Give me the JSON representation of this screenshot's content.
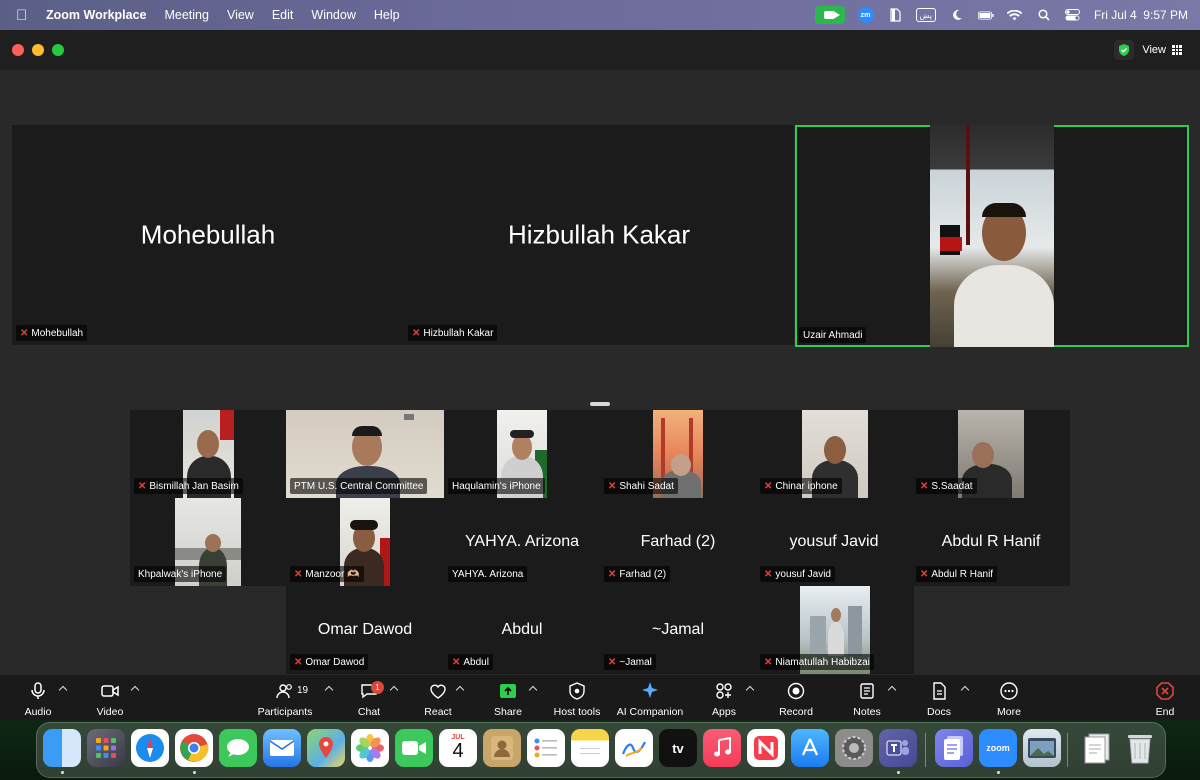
{
  "menubar": {
    "app_name": "Zoom Workplace",
    "menus": [
      "Meeting",
      "View",
      "Edit",
      "Window",
      "Help"
    ],
    "zm_badge": "zm",
    "input_source": "پښ",
    "datetime": "Fri Jul 4  9:57 PM"
  },
  "window": {
    "view_label": "View"
  },
  "spotlight": [
    {
      "name": "Mohebullah",
      "label": "Mohebullah",
      "muted": true,
      "video": false
    },
    {
      "name": "Hizbullah Kakar",
      "label": "Hizbullah Kakar",
      "muted": true,
      "video": false
    },
    {
      "name": "",
      "label": "Uzair Ahmadi",
      "muted": false,
      "video": true,
      "active": true
    }
  ],
  "gallery": {
    "row1": [
      {
        "label": "Bismillah Jan Basim",
        "muted": true,
        "video": true
      },
      {
        "label": "PTM U.S. Central Committee",
        "muted": false,
        "video": true
      },
      {
        "label": "Haqulamin's iPhone",
        "muted": false,
        "video": true
      },
      {
        "label": "Shahi Sadat",
        "muted": true,
        "video": true
      },
      {
        "label": "Chinar iphone",
        "muted": true,
        "video": true
      },
      {
        "label": "S.Saadat",
        "muted": true,
        "video": true
      }
    ],
    "row2": [
      {
        "label": "Khpalwak's iPhone",
        "muted": false,
        "video": true
      },
      {
        "label": "Manzoor 🫶🏼",
        "muted": true,
        "video": true
      },
      {
        "name": "YAHYA. Arizona",
        "label": "YAHYA. Arizona",
        "muted": false,
        "video": false
      },
      {
        "name": "Farhad (2)",
        "label": "Farhad (2)",
        "muted": true,
        "video": false
      },
      {
        "name": "yousuf Javid",
        "label": "yousuf Javid",
        "muted": true,
        "video": false
      },
      {
        "name": "Abdul R Hanif",
        "label": "Abdul R Hanif",
        "muted": true,
        "video": false
      }
    ],
    "row3": [
      {
        "name": "Omar Dawod",
        "label": "Omar Dawod",
        "muted": true,
        "video": false
      },
      {
        "name": "Abdul",
        "label": "Abdul",
        "muted": true,
        "video": false
      },
      {
        "name": "~Jamal",
        "label": "~Jamal",
        "muted": true,
        "video": false
      },
      {
        "label": "Niamatullah Habibzai",
        "muted": true,
        "video": true
      }
    ]
  },
  "toolbar": {
    "audio": "Audio",
    "video": "Video",
    "participants": "Participants",
    "participants_count": "19",
    "chat": "Chat",
    "chat_badge": "1",
    "react": "React",
    "share": "Share",
    "host_tools": "Host tools",
    "ai_companion": "AI Companion",
    "apps": "Apps",
    "record": "Record",
    "notes": "Notes",
    "docs": "Docs",
    "more": "More",
    "end": "End"
  },
  "dock": {
    "calendar_month": "JUL",
    "calendar_day": "4",
    "tv_label": "tv",
    "zoom_label": "zoom"
  },
  "colors": {
    "active_speaker": "#2ecc4f",
    "mute": "#e0453a",
    "share_green": "#2ecc4f",
    "end_red": "#e0453a"
  }
}
